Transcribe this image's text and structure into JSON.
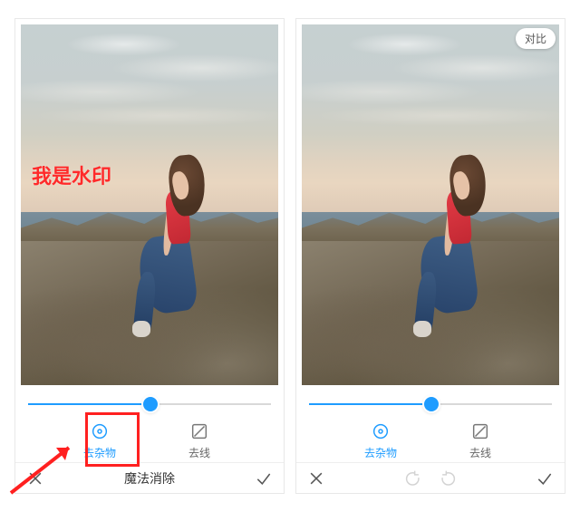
{
  "panels": {
    "left": {
      "watermark_text": "我是水印",
      "slider_percent": 50,
      "tools": [
        {
          "key": "remove_object",
          "label": "去杂物",
          "active": true
        },
        {
          "key": "remove_line",
          "label": "去线",
          "active": false
        }
      ],
      "bottom": {
        "title": "魔法消除",
        "show_undo_redo": false
      }
    },
    "right": {
      "compare_label": "对比",
      "slider_percent": 50,
      "tools": [
        {
          "key": "remove_object",
          "label": "去杂物",
          "active": true
        },
        {
          "key": "remove_line",
          "label": "去线",
          "active": false
        }
      ],
      "bottom": {
        "title": "",
        "show_undo_redo": true
      }
    }
  },
  "colors": {
    "accent": "#1e9cff",
    "annotation": "#ff2020",
    "watermark": "#ff2a2a"
  }
}
